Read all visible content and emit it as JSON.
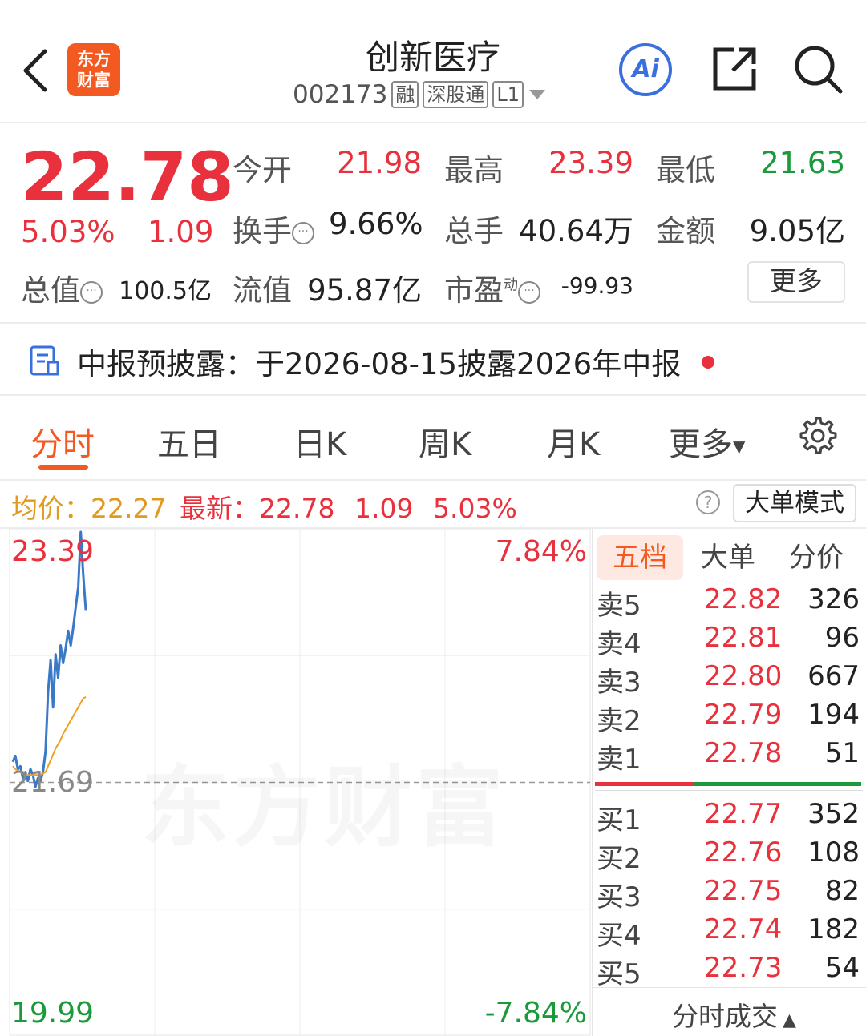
{
  "header": {
    "logo_text": "东方\n财富",
    "title": "创新医疗",
    "code": "002173",
    "tags": [
      "融",
      "深股通",
      "L1"
    ],
    "ai_label": "Ai"
  },
  "quote": {
    "price": "22.78",
    "change_pct": "5.03%",
    "change": "1.09",
    "open_label": "今开",
    "open": "21.98",
    "high_label": "最高",
    "high": "23.39",
    "low_label": "最低",
    "low": "21.63",
    "turnover_label": "换手",
    "turnover": "9.66%",
    "volume_label": "总手",
    "volume": "40.64万",
    "amount_label": "金额",
    "amount": "9.05亿",
    "mktcap_label": "总值",
    "mktcap": "100.5亿",
    "float_label": "流值",
    "float": "95.87亿",
    "pe_label": "市盈",
    "pe_sup": "动",
    "pe": "-99.93",
    "more_label": "更多"
  },
  "notice": {
    "text": "中报预披露：于2026-08-15披露2026年中报"
  },
  "tabs": [
    "分时",
    "五日",
    "日K",
    "周K",
    "月K",
    "更多"
  ],
  "infobar": {
    "avg_label": "均价：",
    "avg": "22.27",
    "latest_label": "最新：",
    "latest": "22.78",
    "chg": "1.09",
    "chg_pct": "5.03%",
    "mode_button": "大单模式"
  },
  "chart_data": {
    "type": "line",
    "y_top_label": "23.39",
    "y_mid_label": "21.69",
    "y_bottom_label": "19.99",
    "pct_top": "7.84%",
    "pct_bottom": "-7.84%",
    "watermark": "东方财富",
    "ylim": [
      19.99,
      23.39
    ],
    "prev_close": 21.69,
    "series": [
      {
        "values": [
          21.83,
          21.87,
          21.78,
          21.8,
          21.72,
          21.76,
          21.7,
          21.78,
          21.74,
          21.66,
          21.72,
          21.7,
          21.76,
          21.9,
          22.3,
          22.52,
          22.2,
          22.56,
          22.4,
          22.62,
          22.5,
          22.6,
          22.72,
          22.62,
          22.74,
          22.88,
          23.02,
          23.39,
          23.1,
          22.86
        ]
      },
      {
        "values": [
          21.8,
          21.78,
          21.77,
          21.76,
          21.75,
          21.74,
          21.74,
          21.74,
          21.74,
          21.74,
          21.74,
          21.74,
          21.75,
          21.76,
          21.8,
          21.84,
          21.88,
          21.92,
          21.95,
          21.98,
          22.02,
          22.05,
          22.08,
          22.11,
          22.14,
          22.17,
          22.2,
          22.23,
          22.26,
          22.27
        ]
      }
    ]
  },
  "book": {
    "tabs": [
      "五档",
      "大单",
      "分价"
    ],
    "asks": [
      {
        "label": "卖5",
        "price": "22.82",
        "vol": "326"
      },
      {
        "label": "卖4",
        "price": "22.81",
        "vol": "96"
      },
      {
        "label": "卖3",
        "price": "22.80",
        "vol": "667"
      },
      {
        "label": "卖2",
        "price": "22.79",
        "vol": "194"
      },
      {
        "label": "卖1",
        "price": "22.78",
        "vol": "51"
      }
    ],
    "bids": [
      {
        "label": "买1",
        "price": "22.77",
        "vol": "352"
      },
      {
        "label": "买2",
        "price": "22.76",
        "vol": "108"
      },
      {
        "label": "买3",
        "price": "22.75",
        "vol": "82"
      },
      {
        "label": "买4",
        "price": "22.74",
        "vol": "182"
      },
      {
        "label": "买5",
        "price": "22.73",
        "vol": "54"
      }
    ],
    "footer": "分时成交"
  },
  "colors": {
    "up": "#e8313c",
    "down": "#1a9a3a",
    "accent": "#f35a21",
    "price_line": "#3a78c8",
    "avg_line": "#f0a020"
  }
}
